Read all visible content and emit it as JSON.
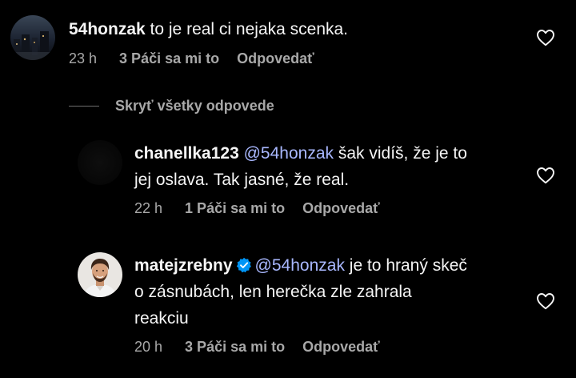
{
  "comments": [
    {
      "username": "54honzak",
      "text": "to je real ci nejaka scenka.",
      "mention": "",
      "time": "23 h",
      "likes": "3 Páči sa mi to",
      "reply": "Odpovedať",
      "avatar": "dark-cityscape-avatar"
    },
    {
      "username": "chanellka123",
      "mention": "@54honzak",
      "text_line1": "šak vidíš, že je to",
      "text_line2": "jej oslava. Tak jasné, že real.",
      "time": "22 h",
      "likes": "1 Páči sa mi to",
      "reply": "Odpovedať",
      "avatar": "dark-avatar"
    },
    {
      "username": "matejzrebny",
      "verified": true,
      "mention": "@54honzak",
      "text_line1": "je to hraný skeč",
      "text_line2": "o zásnubách, len herečka zle zahrala",
      "text_line3": "reakciu",
      "time": "20 h",
      "likes": "3 Páči sa mi to",
      "reply": "Odpovedať",
      "avatar": "man-portrait-avatar"
    }
  ],
  "hide_replies_label": "Skryť všetky odpovede",
  "colors": {
    "background": "#000000",
    "text": "#f5f5f5",
    "meta": "#a8a8a8",
    "mention": "#a9b8ff",
    "verified": "#0095f6"
  },
  "icons": {
    "like": "heart-outline-icon",
    "verified": "verified-badge-icon"
  }
}
